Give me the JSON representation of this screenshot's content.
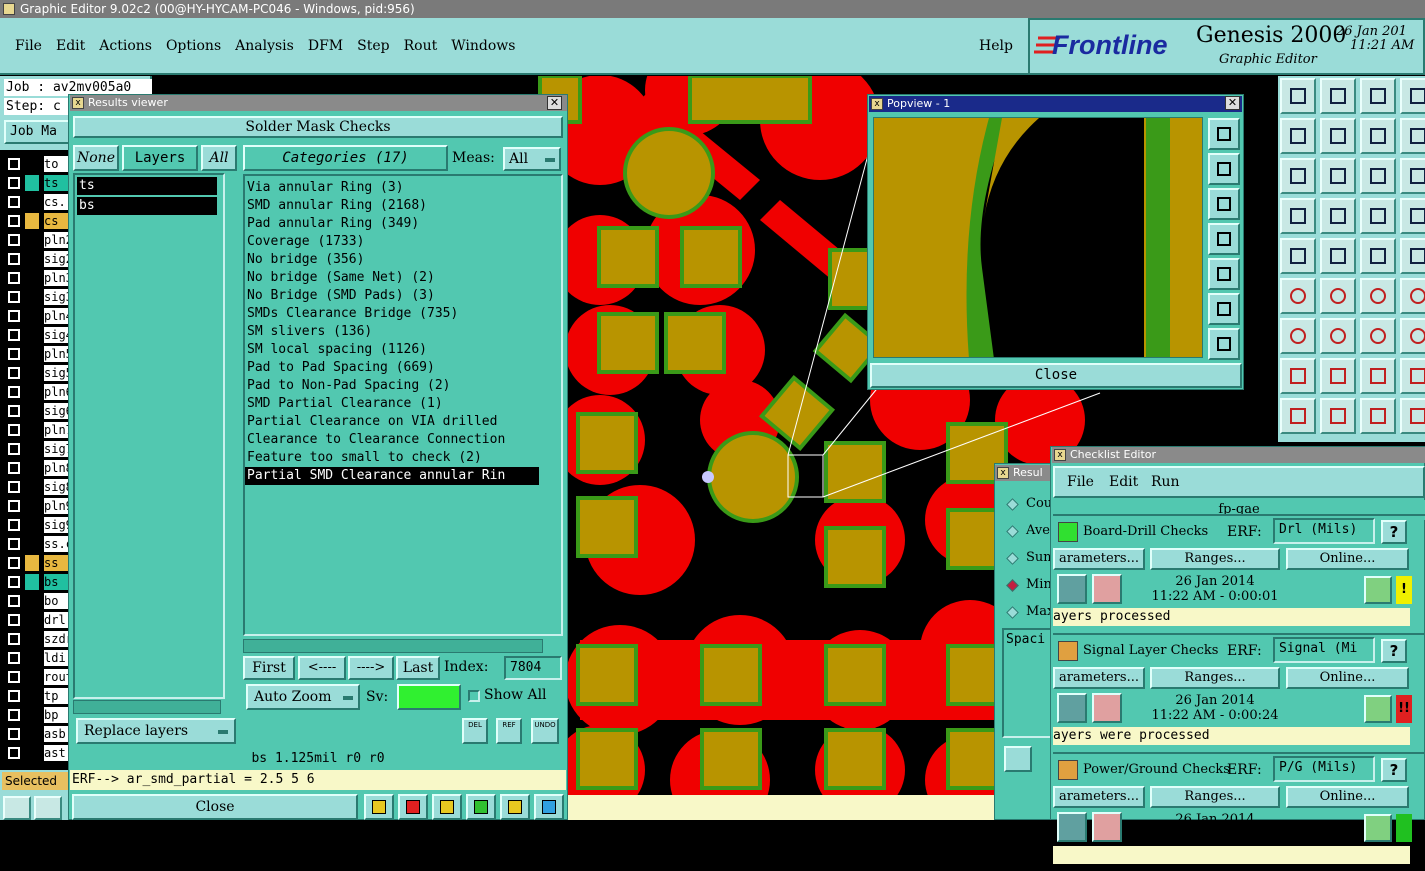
{
  "app": {
    "title": "Graphic Editor 9.02c2 (00@HY-HYCAM-PC046 - Windows, pid:956)"
  },
  "menu": [
    "File",
    "Edit",
    "Actions",
    "Options",
    "Analysis",
    "DFM",
    "Step",
    "Rout",
    "Windows"
  ],
  "help": "Help",
  "brand": {
    "logo": "Frontline",
    "product": "Genesis 2000",
    "sub": "Graphic Editor",
    "date": "26 Jan 201",
    "time": "11:21 AM"
  },
  "job": {
    "job": "Job : av2mv005a0",
    "step": "Step: c",
    "matrix": "Job Ma"
  },
  "layers": [
    {
      "name": "to",
      "color": "#ffffff"
    },
    {
      "name": "ts",
      "color": "#20c0a0"
    },
    {
      "name": "cs.",
      "color": "#ffffff"
    },
    {
      "name": "cs",
      "color": "#e8b840"
    },
    {
      "name": "pln2",
      "color": "#ffffff"
    },
    {
      "name": "sig2",
      "color": "#ffffff"
    },
    {
      "name": "pln3",
      "color": "#ffffff"
    },
    {
      "name": "sig3",
      "color": "#ffffff"
    },
    {
      "name": "pln4",
      "color": "#ffffff"
    },
    {
      "name": "sig4",
      "color": "#ffffff"
    },
    {
      "name": "pln5",
      "color": "#ffffff"
    },
    {
      "name": "sig5",
      "color": "#ffffff"
    },
    {
      "name": "pln6",
      "color": "#ffffff"
    },
    {
      "name": "sig6",
      "color": "#ffffff"
    },
    {
      "name": "pln7",
      "color": "#ffffff"
    },
    {
      "name": "sig7",
      "color": "#ffffff"
    },
    {
      "name": "pln8",
      "color": "#ffffff"
    },
    {
      "name": "sig8",
      "color": "#ffffff"
    },
    {
      "name": "pln9",
      "color": "#ffffff"
    },
    {
      "name": "sig9",
      "color": "#ffffff"
    },
    {
      "name": "ss.c",
      "color": "#ffffff"
    },
    {
      "name": "ss",
      "color": "#e8b840"
    },
    {
      "name": "bs",
      "color": "#20c0a0"
    },
    {
      "name": "bo",
      "color": "#ffffff"
    },
    {
      "name": "drl",
      "color": "#ffffff"
    },
    {
      "name": "szdr",
      "color": "#ffffff"
    },
    {
      "name": "ldi",
      "color": "#ffffff"
    },
    {
      "name": "rout",
      "color": "#ffffff"
    },
    {
      "name": "tp",
      "color": "#ffffff"
    },
    {
      "name": "bp",
      "color": "#ffffff"
    },
    {
      "name": "asb",
      "color": "#ffffff"
    },
    {
      "name": "ast",
      "color": "#ffffff"
    }
  ],
  "selected": "Selected",
  "results": {
    "title": "Results viewer",
    "header": "Solder Mask Checks",
    "none": "None",
    "layers_btn": "Layers",
    "all": "All",
    "layer_list": [
      "ts",
      "bs"
    ],
    "categories_btn": "Categories (17)",
    "meas_label": "Meas:",
    "meas_value": "All",
    "categories": [
      "Via annular Ring (3)",
      "SMD annular Ring (2168)",
      "Pad annular Ring (349)",
      "Coverage (1733)",
      "No bridge (356)",
      "No bridge (Same Net) (2)",
      "No Bridge (SMD Pads) (3)",
      "SMDs Clearance Bridge (735)",
      "SM slivers (136)",
      "SM local spacing (1126)",
      "Pad to Pad Spacing (669)",
      "Pad to Non-Pad Spacing (2)",
      "SMD Partial Clearance (1)",
      "Partial Clearance on VIA drilled",
      "Clearance to Clearance Connection",
      "Feature too small to check (2)",
      "Partial SMD Clearance annular Rin"
    ],
    "first": "First",
    "prev": "<----",
    "next": "---->",
    "last": "Last",
    "index_label": "Index:",
    "index_value": "7804",
    "autozoom": "Auto Zoom",
    "sv": "Sv:",
    "showall": "Show All",
    "replace": "Replace layers",
    "status": "bs 1.125mil  r0  r0",
    "erf": "ERF--> ar_smd_partial = 2.5 5 6",
    "close": "Close",
    "del": "DEL",
    "ref": "REF",
    "undo": "UNDO"
  },
  "popview": {
    "title": "Popview - 1",
    "close": "Close"
  },
  "checklist": {
    "title": "Checklist Editor",
    "menu": [
      "File",
      "Edit",
      "Run"
    ],
    "name": "fp-qae",
    "rows": [
      {
        "label": "Board-Drill Checks",
        "erf": "ERF:",
        "erf_value": "Drl (Mils)",
        "param": "arameters...",
        "ranges": "Ranges...",
        "online": "Online...",
        "date": "26 Jan 2014",
        "time": "11:22 AM - 0:00:01",
        "status": "!",
        "status_color": "#f0f000",
        "msg": "ayers processed"
      },
      {
        "label": "Signal Layer Checks",
        "erf": "ERF:",
        "erf_value": "Signal (Mi",
        "param": "arameters...",
        "ranges": "Ranges...",
        "online": "Online...",
        "date": "26 Jan 2014",
        "time": "11:22 AM - 0:00:24",
        "status": "!!",
        "status_color": "#e02020",
        "msg": "ayers were processed"
      },
      {
        "label": "Power/Ground Checks",
        "erf": "ERF:",
        "erf_value": "P/G (Mils)",
        "param": "arameters...",
        "ranges": "Ranges...",
        "online": "Online...",
        "date": "26 Jan 2014",
        "time": "",
        "status": "",
        "status_color": "#20c020",
        "msg": ""
      }
    ],
    "q": "?"
  },
  "results2": {
    "title": "Resul",
    "items": [
      "Cou",
      "Ave",
      "Sum",
      "Min",
      "Max"
    ],
    "spac": "Spaci"
  }
}
